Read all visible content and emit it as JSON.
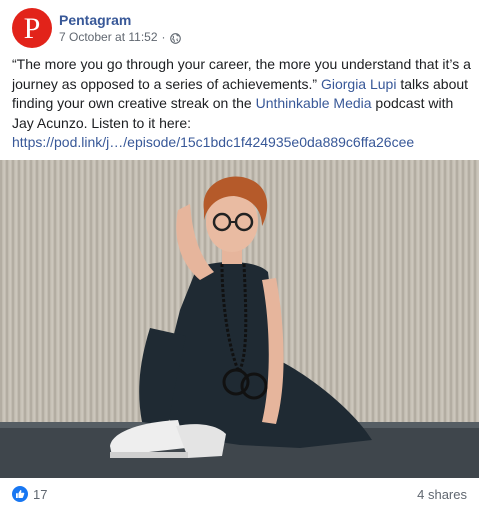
{
  "post": {
    "page_name": "Pentagram",
    "avatar_letter": "P",
    "timestamp": "7 October at 11:52",
    "separator": "·",
    "audience_icon": "globe-icon",
    "text": {
      "quote": "“The more you go through your career, the more you understand that it’s a journey as opposed to a series of achievements.” ",
      "mention_1": "Giorgia Lupi",
      "middle": " talks about finding your own creative streak on the ",
      "mention_2": "Unthinkable Media",
      "after": " podcast with Jay Acunzo. Listen to it here: ",
      "link": "https://pod.link/j…/episode/15c1bdc1f424935e0da889c6ffa26cee"
    }
  },
  "stats": {
    "reaction_icon": "like-icon",
    "like_count": "17",
    "shares": "4 shares"
  },
  "colors": {
    "brand_red": "#e2231a",
    "link_blue": "#385898",
    "like_blue": "#1877f2",
    "meta_gray": "#606770"
  }
}
